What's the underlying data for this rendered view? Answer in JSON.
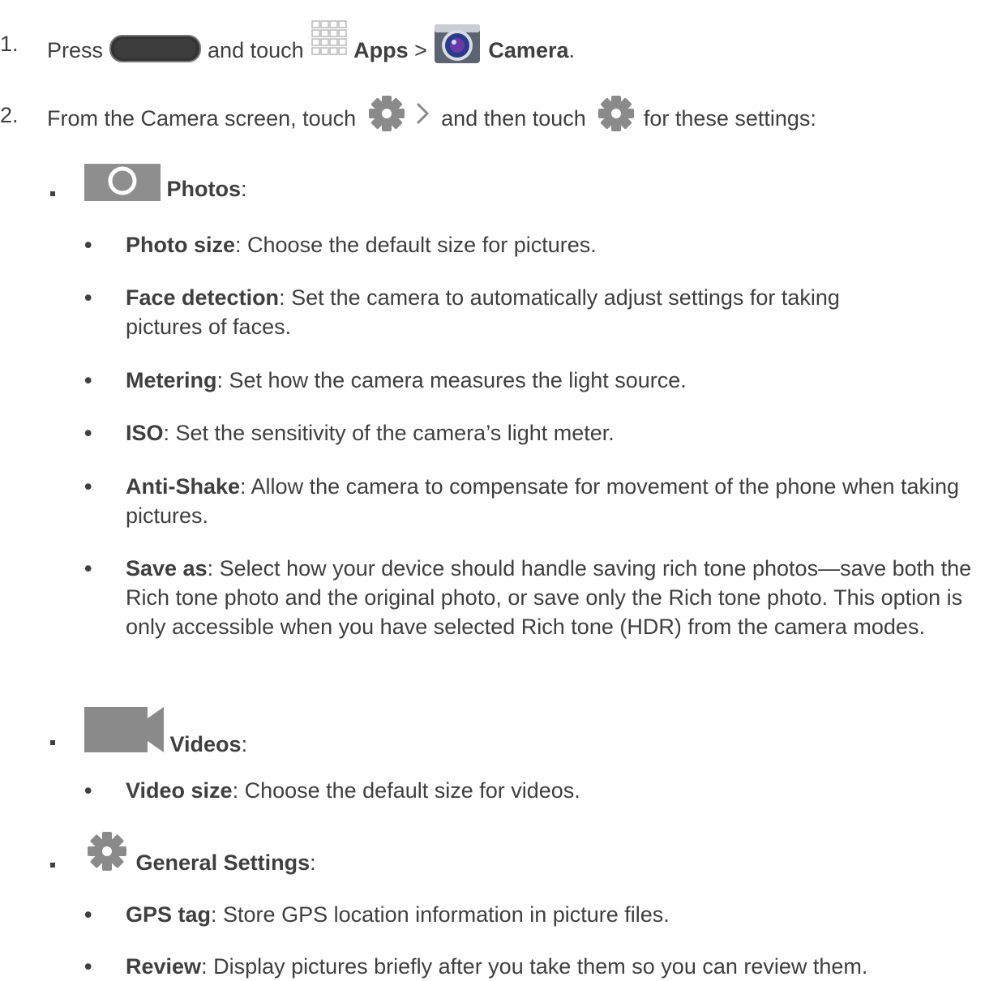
{
  "steps": [
    {
      "number": "1.",
      "t1": "Press ",
      "t2": " and touch ",
      "apps": "Apps",
      "sep": " > ",
      "camera": "Camera",
      "end": "."
    },
    {
      "number": "2.",
      "t1": "From the Camera screen, touch ",
      "t2": " and then touch ",
      "t3": " for these settings:"
    }
  ],
  "sections": {
    "photos": {
      "label": "Photos",
      "colon": ":"
    },
    "videos": {
      "label": "Videos",
      "colon": ":"
    },
    "general": {
      "label": "General Settings",
      "colon": ":"
    }
  },
  "items": {
    "photo_size": {
      "term": "Photo size",
      "desc": ": Choose the default size for pictures."
    },
    "face_detection": {
      "term": "Face detection",
      "desc": ": Set the camera to automatically adjust settings for taking pictures of faces."
    },
    "metering": {
      "term": "Metering",
      "desc": ": Set how the camera measures the light source."
    },
    "iso": {
      "term": "ISO",
      "desc": ": Set the sensitivity of the camera’s light meter."
    },
    "anti_shake": {
      "term": "Anti-Shake",
      "desc": ": Allow the camera to compensate for movement of the phone when taking pictures."
    },
    "save_as": {
      "term": "Save as",
      "desc": ": Select how your device should handle saving rich tone photos—save both the Rich tone photo and the original photo, or save only the Rich tone photo. This option is only accessible when you have selected Rich tone (HDR) from the camera modes."
    },
    "video_size": {
      "term": "Video size",
      "desc": ": Choose the default size for videos."
    },
    "gps_tag": {
      "term": "GPS tag",
      "desc": ": Store GPS location information in picture files."
    },
    "review": {
      "term": "Review",
      "desc": ": Display pictures briefly after you take them so you can review them."
    }
  },
  "bullet": "•",
  "icons": {
    "home_button": "home-button-icon",
    "apps": "apps-grid-icon",
    "camera": "camera-app-icon",
    "settings_expand": "gear-chevron-icon",
    "settings": "gear-icon",
    "photos": "camera-icon",
    "videos": "video-camera-icon",
    "general": "gear-icon"
  },
  "colors": {
    "text": "#3f3f3f",
    "icon_gray": "#8a8a8a"
  }
}
